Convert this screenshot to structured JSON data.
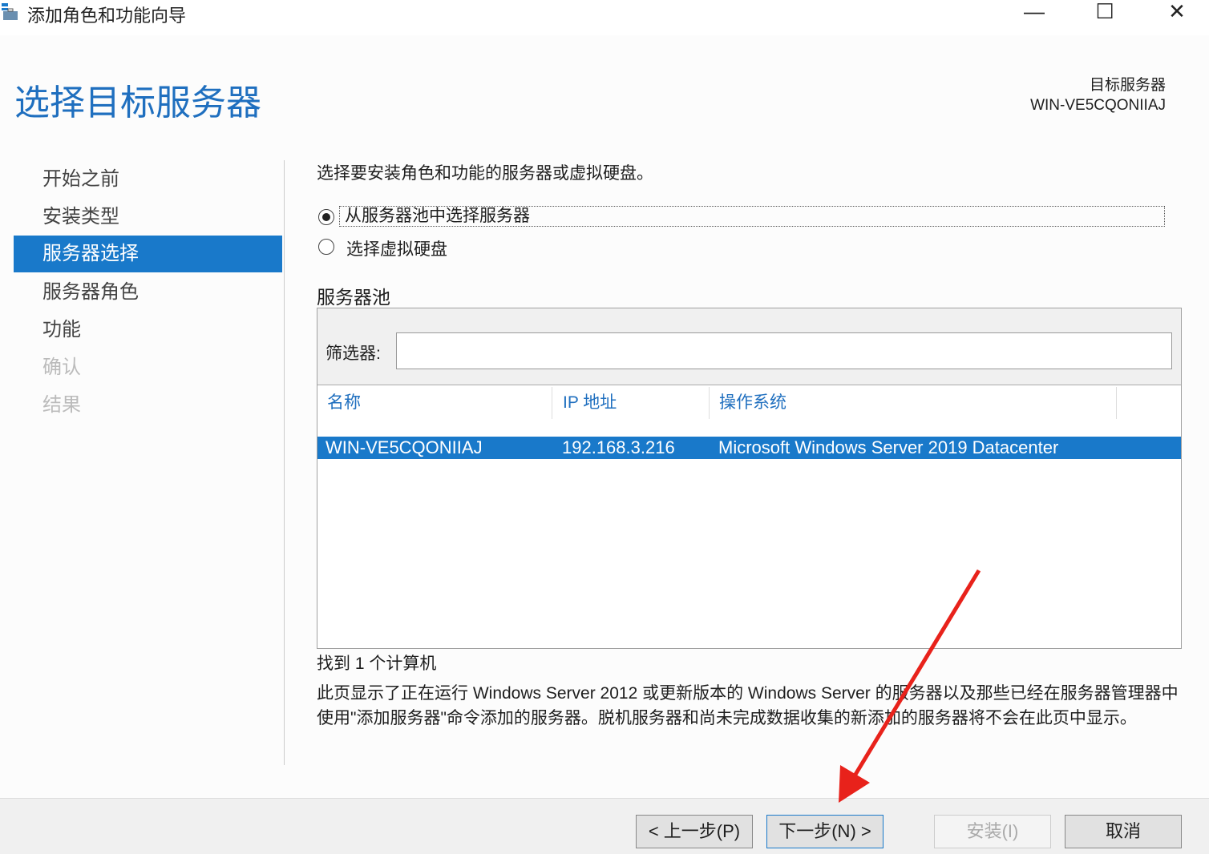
{
  "window": {
    "title": "添加角色和功能向导",
    "minimize": "—",
    "maximize": "☐",
    "close": "✕"
  },
  "page_title": "选择目标服务器",
  "destination": {
    "label": "目标服务器",
    "server": "WIN-VE5CQONIIAJ"
  },
  "nav": [
    {
      "label": "开始之前"
    },
    {
      "label": "安装类型"
    },
    {
      "label": "服务器选择"
    },
    {
      "label": "服务器角色"
    },
    {
      "label": "功能"
    },
    {
      "label": "确认"
    },
    {
      "label": "结果"
    }
  ],
  "instruction": "选择要安装角色和功能的服务器或虚拟硬盘。",
  "options": {
    "pool": "从服务器池中选择服务器",
    "vhd": "选择虚拟硬盘"
  },
  "pool": {
    "title": "服务器池",
    "filter_label": "筛选器:",
    "filter_value": "",
    "columns": [
      "名称",
      "IP 地址",
      "操作系统"
    ],
    "rows": [
      {
        "name": "WIN-VE5CQONIIAJ",
        "ip": "192.168.3.216",
        "os": "Microsoft Windows Server 2019 Datacenter"
      }
    ]
  },
  "found": "找到 1 个计算机",
  "description": "此页显示了正在运行 Windows Server 2012 或更新版本的 Windows Server 的服务器以及那些已经在服务器管理器中使用\"添加服务器\"命令添加的服务器。脱机服务器和尚未完成数据收集的新添加的服务器将不会在此页中显示。",
  "buttons": {
    "prev": "< 上一步(P)",
    "next": "下一步(N) >",
    "install": "安装(I)",
    "cancel": "取消"
  },
  "colors": {
    "accent": "#1979ca",
    "arrow": "#e8221b"
  }
}
